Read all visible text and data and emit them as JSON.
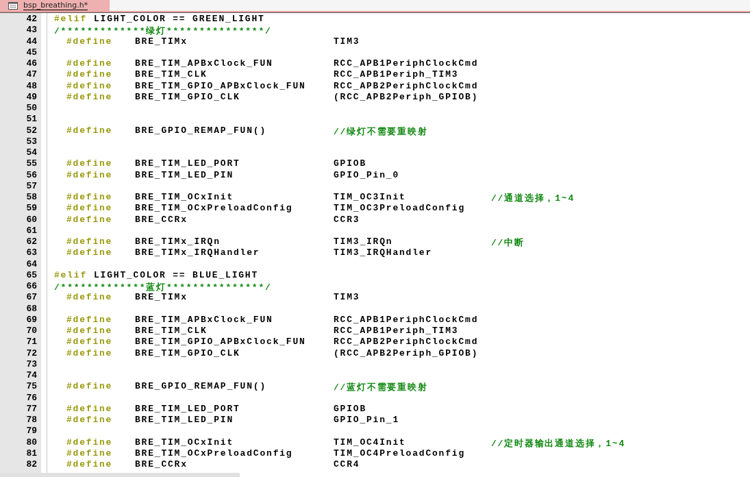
{
  "tab": {
    "label": "bsp_breathing.h*",
    "selected": true
  },
  "lines": [
    {
      "number": "42",
      "kind": "plain",
      "tokens": [
        {
          "kind": "directive",
          "text": "#elif"
        },
        {
          "kind": "text",
          "text": "LIGHT_COLOR == GREEN_LIGHT"
        }
      ]
    },
    {
      "number": "43",
      "kind": "plain",
      "tokens": [
        {
          "kind": "comment",
          "text": "/*************绿灯***************/"
        }
      ]
    },
    {
      "number": "44",
      "kind": "define",
      "tokens": [
        {
          "kind": "directive",
          "text": "#define"
        },
        {
          "kind": "name",
          "text": "BRE_TIMx"
        },
        {
          "kind": "value",
          "text": "TIM3"
        }
      ]
    },
    {
      "number": "45",
      "kind": "plain"
    },
    {
      "number": "46",
      "kind": "define",
      "tokens": [
        {
          "kind": "directive",
          "text": "#define"
        },
        {
          "kind": "name",
          "text": "BRE_TIM_APBxClock_FUN"
        },
        {
          "kind": "value",
          "text": "RCC_APB1PeriphClockCmd"
        }
      ]
    },
    {
      "number": "47",
      "kind": "define",
      "tokens": [
        {
          "kind": "directive",
          "text": "#define"
        },
        {
          "kind": "name",
          "text": "BRE_TIM_CLK"
        },
        {
          "kind": "value",
          "text": "RCC_APB1Periph_TIM3"
        }
      ]
    },
    {
      "number": "48",
      "kind": "define",
      "tokens": [
        {
          "kind": "directive",
          "text": "#define"
        },
        {
          "kind": "name",
          "text": "BRE_TIM_GPIO_APBxClock_FUN"
        },
        {
          "kind": "value",
          "text": "RCC_APB2PeriphClockCmd"
        }
      ]
    },
    {
      "number": "49",
      "kind": "define",
      "tokens": [
        {
          "kind": "directive",
          "text": "#define"
        },
        {
          "kind": "name",
          "text": "BRE_TIM_GPIO_CLK"
        },
        {
          "kind": "value",
          "text": "(RCC_APB2Periph_GPIOB)"
        }
      ]
    },
    {
      "number": "50",
      "kind": "plain"
    },
    {
      "number": "51",
      "kind": "plain"
    },
    {
      "number": "52",
      "kind": "define",
      "tokens": [
        {
          "kind": "directive",
          "text": "#define"
        },
        {
          "kind": "name",
          "text": "BRE_GPIO_REMAP_FUN()"
        },
        {
          "kind": "comment",
          "text": "//绿灯不需要重映射"
        }
      ]
    },
    {
      "number": "53",
      "kind": "plain"
    },
    {
      "number": "54",
      "kind": "plain"
    },
    {
      "number": "55",
      "kind": "define",
      "tokens": [
        {
          "kind": "directive",
          "text": "#define"
        },
        {
          "kind": "name",
          "text": "BRE_TIM_LED_PORT"
        },
        {
          "kind": "value",
          "text": "GPIOB"
        }
      ]
    },
    {
      "number": "56",
      "kind": "define",
      "tokens": [
        {
          "kind": "directive",
          "text": "#define"
        },
        {
          "kind": "name",
          "text": "BRE_TIM_LED_PIN"
        },
        {
          "kind": "value",
          "text": "GPIO_Pin_0"
        }
      ]
    },
    {
      "number": "57",
      "kind": "plain"
    },
    {
      "number": "58",
      "kind": "define",
      "tokens": [
        {
          "kind": "directive",
          "text": "#define"
        },
        {
          "kind": "name",
          "text": "BRE_TIM_OCxInit"
        },
        {
          "kind": "value",
          "text": "TIM_OC3Init"
        },
        {
          "kind": "comment",
          "text": "//通道选择，1~4"
        }
      ]
    },
    {
      "number": "59",
      "kind": "define",
      "tokens": [
        {
          "kind": "directive",
          "text": "#define"
        },
        {
          "kind": "name",
          "text": "BRE_TIM_OCxPreloadConfig"
        },
        {
          "kind": "value",
          "text": "TIM_OC3PreloadConfig"
        }
      ]
    },
    {
      "number": "60",
      "kind": "define",
      "tokens": [
        {
          "kind": "directive",
          "text": "#define"
        },
        {
          "kind": "name",
          "text": "BRE_CCRx"
        },
        {
          "kind": "value",
          "text": "CCR3"
        }
      ]
    },
    {
      "number": "61",
      "kind": "plain"
    },
    {
      "number": "62",
      "kind": "define",
      "tokens": [
        {
          "kind": "directive",
          "text": "#define"
        },
        {
          "kind": "name",
          "text": "BRE_TIMx_IRQn"
        },
        {
          "kind": "value",
          "text": "TIM3_IRQn"
        },
        {
          "kind": "comment",
          "text": "//中断"
        }
      ]
    },
    {
      "number": "63",
      "kind": "define",
      "tokens": [
        {
          "kind": "directive",
          "text": "#define"
        },
        {
          "kind": "name",
          "text": "BRE_TIMx_IRQHandler"
        },
        {
          "kind": "value",
          "text": "TIM3_IRQHandler"
        }
      ]
    },
    {
      "number": "64",
      "kind": "plain"
    },
    {
      "number": "65",
      "kind": "plain",
      "tokens": [
        {
          "kind": "directive",
          "text": "#elif"
        },
        {
          "kind": "text",
          "text": "LIGHT_COLOR == BLUE_LIGHT"
        }
      ]
    },
    {
      "number": "66",
      "kind": "plain",
      "tokens": [
        {
          "kind": "comment",
          "text": "/*************蓝灯***************/"
        }
      ]
    },
    {
      "number": "67",
      "kind": "define",
      "tokens": [
        {
          "kind": "directive",
          "text": "#define"
        },
        {
          "kind": "name",
          "text": "BRE_TIMx"
        },
        {
          "kind": "value",
          "text": "TIM3"
        }
      ]
    },
    {
      "number": "68",
      "kind": "plain"
    },
    {
      "number": "69",
      "kind": "define",
      "tokens": [
        {
          "kind": "directive",
          "text": "#define"
        },
        {
          "kind": "name",
          "text": "BRE_TIM_APBxClock_FUN"
        },
        {
          "kind": "value",
          "text": "RCC_APB1PeriphClockCmd"
        }
      ]
    },
    {
      "number": "70",
      "kind": "define",
      "tokens": [
        {
          "kind": "directive",
          "text": "#define"
        },
        {
          "kind": "name",
          "text": "BRE_TIM_CLK"
        },
        {
          "kind": "value",
          "text": "RCC_APB1Periph_TIM3"
        }
      ]
    },
    {
      "number": "71",
      "kind": "define",
      "tokens": [
        {
          "kind": "directive",
          "text": "#define"
        },
        {
          "kind": "name",
          "text": "BRE_TIM_GPIO_APBxClock_FUN"
        },
        {
          "kind": "value",
          "text": "RCC_APB2PeriphClockCmd"
        }
      ]
    },
    {
      "number": "72",
      "kind": "define",
      "tokens": [
        {
          "kind": "directive",
          "text": "#define"
        },
        {
          "kind": "name",
          "text": "BRE_TIM_GPIO_CLK"
        },
        {
          "kind": "value",
          "text": "(RCC_APB2Periph_GPIOB)"
        }
      ]
    },
    {
      "number": "73",
      "kind": "plain"
    },
    {
      "number": "74",
      "kind": "plain"
    },
    {
      "number": "75",
      "kind": "define",
      "tokens": [
        {
          "kind": "directive",
          "text": "#define"
        },
        {
          "kind": "name",
          "text": "BRE_GPIO_REMAP_FUN()"
        },
        {
          "kind": "comment",
          "text": "//蓝灯不需要重映射"
        }
      ]
    },
    {
      "number": "76",
      "kind": "plain"
    },
    {
      "number": "77",
      "kind": "define",
      "tokens": [
        {
          "kind": "directive",
          "text": "#define"
        },
        {
          "kind": "name",
          "text": "BRE_TIM_LED_PORT"
        },
        {
          "kind": "value",
          "text": "GPIOB"
        }
      ]
    },
    {
      "number": "78",
      "kind": "define",
      "tokens": [
        {
          "kind": "directive",
          "text": "#define"
        },
        {
          "kind": "name",
          "text": "BRE_TIM_LED_PIN"
        },
        {
          "kind": "value",
          "text": "GPIO_Pin_1"
        }
      ]
    },
    {
      "number": "79",
      "kind": "plain"
    },
    {
      "number": "80",
      "kind": "define",
      "tokens": [
        {
          "kind": "directive",
          "text": "#define"
        },
        {
          "kind": "name",
          "text": "BRE_TIM_OCxInit"
        },
        {
          "kind": "value",
          "text": "TIM_OC4Init"
        },
        {
          "kind": "comment",
          "text": "//定时器输出通道选择，1~4"
        }
      ]
    },
    {
      "number": "81",
      "kind": "define",
      "tokens": [
        {
          "kind": "directive",
          "text": "#define"
        },
        {
          "kind": "name",
          "text": "BRE_TIM_OCxPreloadConfig"
        },
        {
          "kind": "value",
          "text": "TIM_OC4PreloadConfig"
        }
      ]
    },
    {
      "number": "82",
      "kind": "define",
      "tokens": [
        {
          "kind": "directive",
          "text": "#define"
        },
        {
          "kind": "name",
          "text": "BRE_CCRx"
        },
        {
          "kind": "value",
          "text": "CCR4"
        }
      ]
    }
  ]
}
